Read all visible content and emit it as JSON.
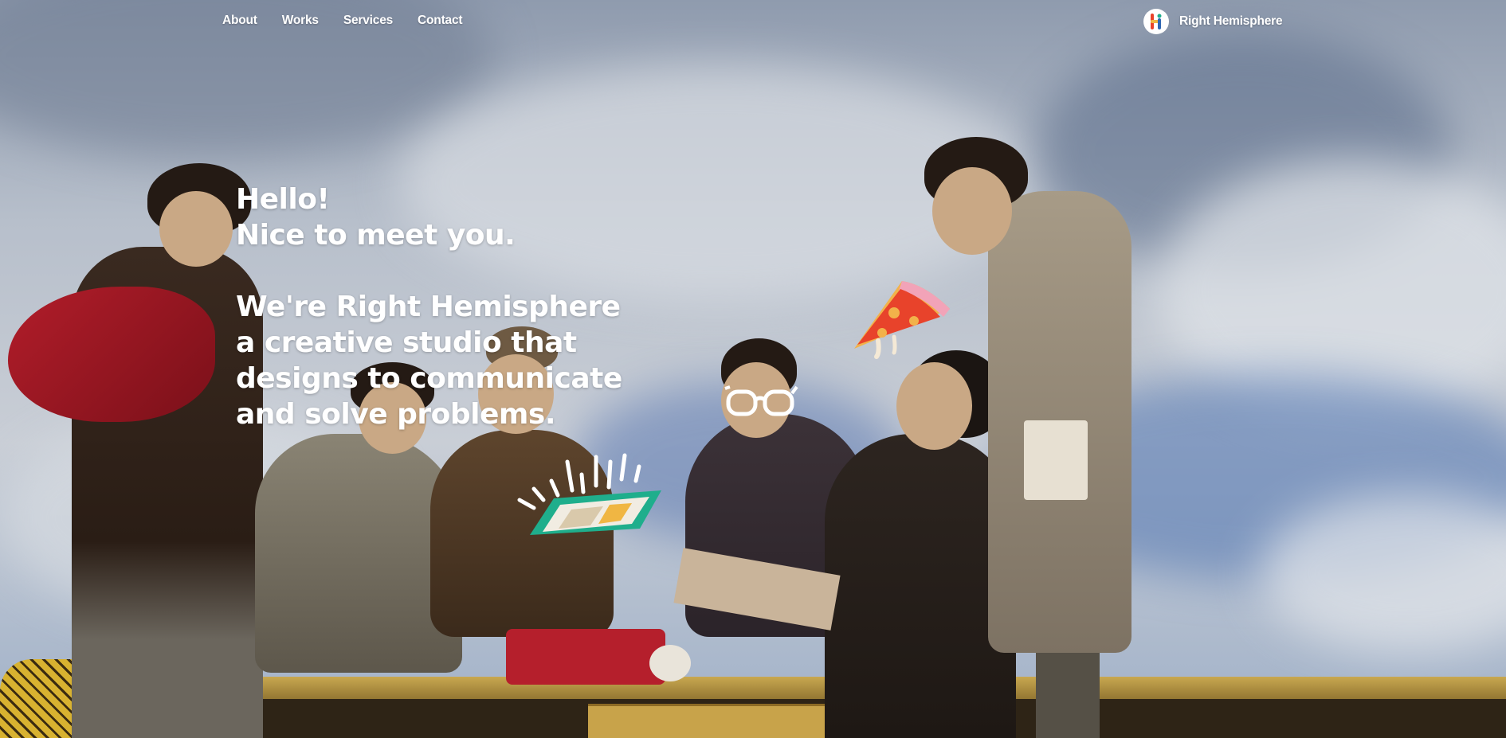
{
  "nav": {
    "links": [
      {
        "label": "About"
      },
      {
        "label": "Works"
      },
      {
        "label": "Services"
      },
      {
        "label": "Contact"
      }
    ]
  },
  "brand": {
    "name": "Right Hemisphere",
    "logo_icon": "right-hemisphere-logo-icon"
  },
  "hero": {
    "greeting": "Hello!",
    "subgreeting": "Nice to meet you.",
    "intro_lines": [
      "We're Right Hemisphere",
      "a creative studio that",
      "designs to communicate",
      "and solve problems."
    ]
  },
  "background": {
    "description_icon": "collage-photo",
    "doodles": [
      "pizza-slice-icon",
      "glasses-icon",
      "tablet-icon",
      "sparkle-lines-icon"
    ]
  },
  "colors": {
    "text": "#ffffff",
    "tablet": "#1fae8c",
    "pizza": "#e8432b",
    "scarf": "#b21d2a"
  }
}
